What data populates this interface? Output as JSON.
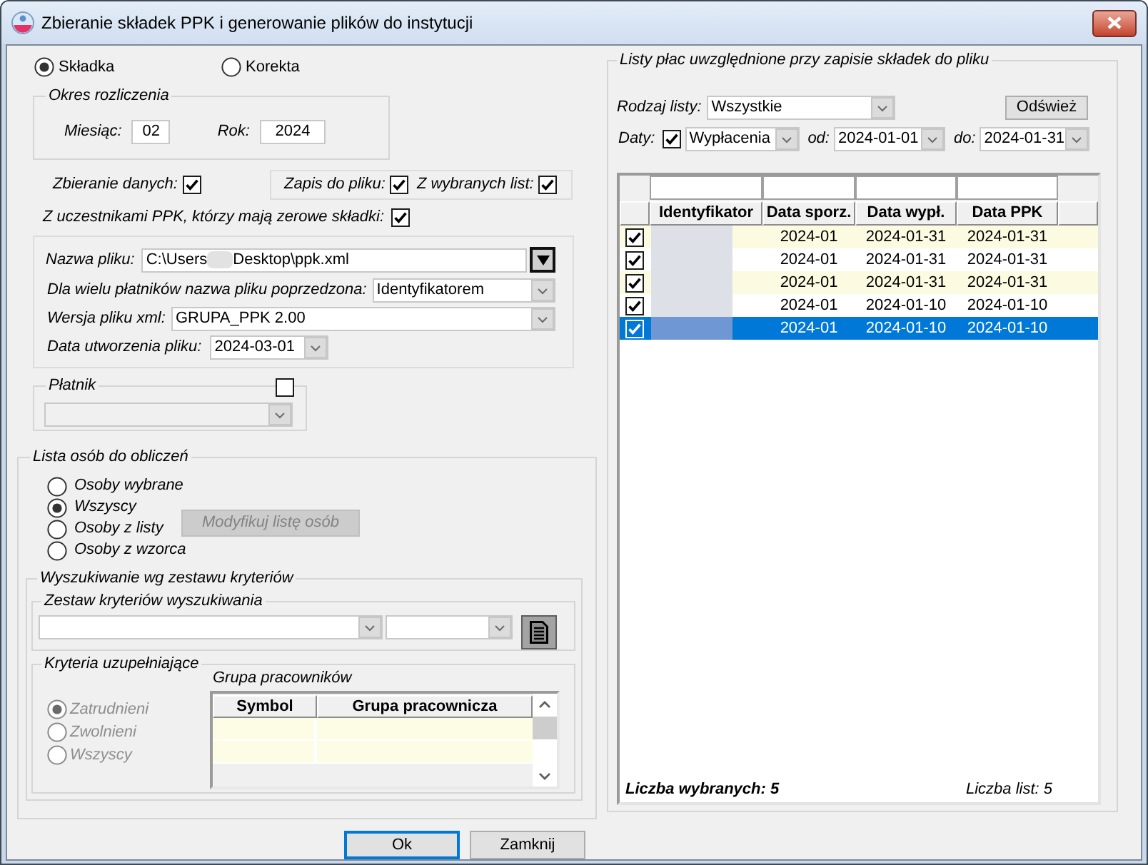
{
  "window": {
    "title": "Zbieranie składek PPK i generowanie plików do instytucji"
  },
  "mode": [
    {
      "label": "Składka",
      "selected": true
    },
    {
      "label": "Korekta",
      "selected": false
    }
  ],
  "settlement_period": {
    "title": "Okres rozliczenia",
    "month": {
      "label": "Miesiąc:",
      "value": "02"
    },
    "year": {
      "label": "Rok:",
      "value": "2024"
    }
  },
  "collect_data": {
    "label": "Zbieranie danych:",
    "checked": true
  },
  "save_options": [
    {
      "label": "Zapis do pliku:",
      "checked": true
    },
    {
      "label": "Z wybranych list:",
      "checked": true
    }
  ],
  "zero_contributions": {
    "label": "Z uczestnikami PPK, którzy mają zerowe składki:",
    "checked": true
  },
  "file": {
    "name": {
      "label": "Nazwa pliku:",
      "value_start": "C:\\Users",
      "value_end": "Desktop\\ppk.xml"
    },
    "prefix": {
      "label": "Dla wielu płatników nazwa pliku poprzedzona:",
      "value": "Identyfikatorem"
    },
    "xml_version": {
      "label": "Wersja pliku xml:",
      "value": "GRUPA_PPK 2.00"
    },
    "created": {
      "label": "Data utworzenia pliku:",
      "value": "2024-03-01"
    }
  },
  "payer": {
    "title": "Płatnik",
    "checked": false,
    "disabled": true
  },
  "people": {
    "title": "Lista osób do obliczeń",
    "options": [
      {
        "label": "Osoby wybrane",
        "selected": false
      },
      {
        "label": "Wszyscy",
        "selected": true
      },
      {
        "label": "Osoby z listy",
        "selected": false
      },
      {
        "label": "Osoby z wzorca",
        "selected": false
      }
    ],
    "modify_button": {
      "label": "Modyfikuj listę osób",
      "disabled": true
    }
  },
  "search": {
    "title": "Wyszukiwanie wg zestawu kryteriów",
    "criteria_set": {
      "title": "Zestaw kryteriów wyszukiwania"
    },
    "supplementary": {
      "title": "Kryteria uzupełniające",
      "options": [
        {
          "label": "Zatrudnieni",
          "selected": true,
          "disabled": true
        },
        {
          "label": "Zwolnieni",
          "selected": false,
          "disabled": true
        },
        {
          "label": "Wszyscy",
          "selected": false,
          "disabled": true
        }
      ],
      "employee_group": {
        "title": "Grupa pracowników",
        "columns": [
          "Symbol",
          "Grupa pracownicza"
        ]
      }
    }
  },
  "payroll": {
    "title": "Listy płac uwzględnione przy zapisie składek do pliku",
    "list_type": {
      "label": "Rodzaj listy:",
      "value": "Wszystkie"
    },
    "refresh_button": "Odśwież",
    "dates": {
      "label": "Daty:",
      "checked": true,
      "type": "Wypłacenia",
      "from_label": "od:",
      "from": "2024-01-01",
      "to_label": "do:",
      "to": "2024-01-31"
    },
    "table": {
      "columns": [
        "Identyfikator",
        "Data sporz.",
        "Data wypł.",
        "Data PPK"
      ],
      "rows": [
        {
          "checked": true,
          "selected": false,
          "identifier_redacted": true,
          "cells": [
            "",
            "2024-01",
            "2024-01-31",
            "2024-01-31"
          ]
        },
        {
          "checked": true,
          "selected": false,
          "identifier_redacted": true,
          "cells": [
            "",
            "2024-01",
            "2024-01-31",
            "2024-01-31"
          ]
        },
        {
          "checked": true,
          "selected": false,
          "identifier_redacted": true,
          "cells": [
            "",
            "2024-01",
            "2024-01-31",
            "2024-01-31"
          ]
        },
        {
          "checked": true,
          "selected": false,
          "identifier_redacted": true,
          "cells": [
            "",
            "2024-01",
            "2024-01-10",
            "2024-01-10"
          ]
        },
        {
          "checked": true,
          "selected": true,
          "identifier_redacted": true,
          "cells": [
            "",
            "2024-01",
            "2024-01-10",
            "2024-01-10"
          ]
        }
      ]
    },
    "selected_count": "Liczba wybranych: 5",
    "list_count": "Liczba list: 5"
  },
  "buttons": [
    {
      "label": "Ok",
      "focused": true
    },
    {
      "label": "Zamknij",
      "focused": false
    }
  ]
}
